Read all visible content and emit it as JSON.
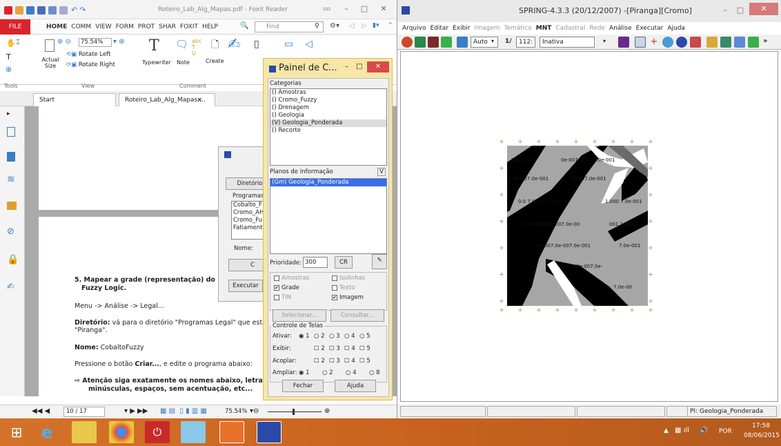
{
  "foxit": {
    "title": "Roteiro_Lab_Alg_Mapas.pdf - Foxit Reader",
    "menu": [
      "FILE",
      "HOME",
      "COMM",
      "VIEW",
      "FORM",
      "PROT",
      "SHAR",
      "FOXIT",
      "HELP"
    ],
    "find_placeholder": "Find",
    "zoom": "75.54%",
    "rotate_left": "Rotate Left",
    "rotate_right": "Rotate Right",
    "actual_size": "Actual Size",
    "typewriter": "Typewriter",
    "note": "Note",
    "create": "Create",
    "group_tools": "Tools",
    "group_view": "View",
    "group_comment": "Comment",
    "tab_start": "Start",
    "tab_doc": "Roteiro_Lab_Alg_Mapas....",
    "page_current": "10 / 17",
    "status_zoom": "75.54%",
    "doc": {
      "step_title_1": "5. Mapear a grade (representação) do PI",
      "step_title_2": "Fuzzy Logic.",
      "menu_path": "Menu -> Análise -> Legal...",
      "dir_label": "Diretório:",
      "dir_text": " vá para o diretório \"Programas Legal\" que está sol",
      "dir_text2": "\"Piranga\".",
      "name_label": "Nome:",
      "name_value": " CobaltoFuzzy",
      "press_pre": "Pressione o botão ",
      "press_bold": "Criar...",
      "press_post": ", e edite o programa abaixo:",
      "attention_1": "Atenção siga exatamente os nomes abaixo, letras r",
      "attention_2": "minúsculas, espaços, sem acentuação, etc..."
    },
    "prog_dialog": {
      "dir_button": "Diretório",
      "programas": "Programas",
      "items": [
        "Cobalto_F",
        "Cromo_AH",
        "Cromo_Fu",
        "Fatiamento"
      ],
      "nome": "Nome:",
      "c_button": "C",
      "executar": "Executar"
    }
  },
  "spring": {
    "title": "SPRING-4.3.3 (20/12/2007) -[Piranga][Cromo]",
    "menu": [
      {
        "label": "Arquivo",
        "enabled": true
      },
      {
        "label": "Editar",
        "enabled": true
      },
      {
        "label": "Exibir",
        "enabled": true
      },
      {
        "label": "Imagem",
        "enabled": false
      },
      {
        "label": "Temático",
        "enabled": false
      },
      {
        "label": "MNT",
        "enabled": true
      },
      {
        "label": "Cadastral",
        "enabled": false
      },
      {
        "label": "Rede",
        "enabled": false
      },
      {
        "label": "Análise",
        "enabled": true
      },
      {
        "label": "Executar",
        "enabled": true
      },
      {
        "label": "Ajuda",
        "enabled": true
      }
    ],
    "toolbar": {
      "auto": "Auto",
      "scale_prefix": "1/",
      "scale": "112:",
      "inativa": "Inativa"
    },
    "status_pi": "PI: Geologia_Ponderada",
    "grid_labels": [
      "7.0e-001",
      "0e-007.0e-007.0e-001",
      "7.0e-007.0e-001",
      "0e-007.0e-001",
      "0.0  7.0e-007.0e-001",
      "1.000 7.0e-001",
      "0  7.0e-007.0e-007.0e-00",
      "001 1.000",
      "7.0e-007.0e-007.0e-001",
      "7.0e-001",
      "0.0  7.0e-007.0e-",
      "7.0e-00"
    ]
  },
  "painel": {
    "title": "Painel de C...",
    "categorias_label": "Categorias",
    "categorias": [
      "() Amostras",
      "() Cromo_Fuzzy",
      "() Drenagem",
      "() Geologia",
      "(V) Geologia_Ponderada",
      "() Recorte"
    ],
    "selected_category": 4,
    "planos_label": "Planos de Informação",
    "planos_v": "V",
    "planos": [
      "(Gm) Geologia_Ponderada"
    ],
    "prioridade_label": "Prioridade:",
    "prioridade": "300",
    "cr": "CR",
    "checks": {
      "amostras": "Amostras",
      "isolinhas": "Isolinhas",
      "grade": "Grade",
      "texto": "Texto",
      "tin": "TIN",
      "imagem": "Imagem"
    },
    "selecionar": "Selecionar...",
    "consultar": "Consultar...",
    "controle_label": "Controle de Telas",
    "ativar": "Ativar:",
    "exibir": "Exibir:",
    "acoplar": "Acoplar:",
    "ampliar": "Ampliar:",
    "nums": [
      "1",
      "2",
      "3",
      "4",
      "5"
    ],
    "ampliar_nums": [
      "1",
      "2",
      "4",
      "8"
    ],
    "fechar": "Fechar",
    "ajuda": "Ajuda"
  },
  "tray": {
    "lang": "POR",
    "time": "17:58",
    "date": "08/06/2015"
  }
}
